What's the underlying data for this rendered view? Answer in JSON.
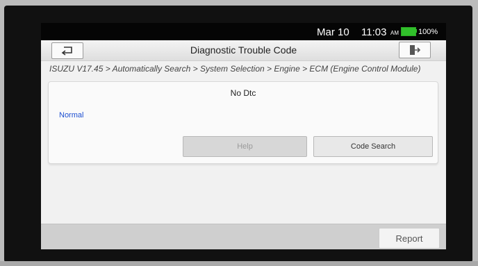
{
  "status_bar": {
    "date": "Mar 10",
    "time": "11:03",
    "ampm": "AM",
    "battery_percent": "100%",
    "battery_level": 1.0
  },
  "header": {
    "title": "Diagnostic Trouble Code",
    "back_icon": "back-arrow-icon",
    "exit_icon": "exit-icon"
  },
  "breadcrumb": "ISUZU V17.45 > Automatically Search > System Selection > Engine > ECM (Engine Control Module)",
  "result": {
    "title": "No Dtc",
    "status": "Normal"
  },
  "buttons": {
    "help": "Help",
    "code_search": "Code Search",
    "report": "Report"
  },
  "colors": {
    "status_text": "#1d4fd1",
    "battery": "#31c02b"
  }
}
